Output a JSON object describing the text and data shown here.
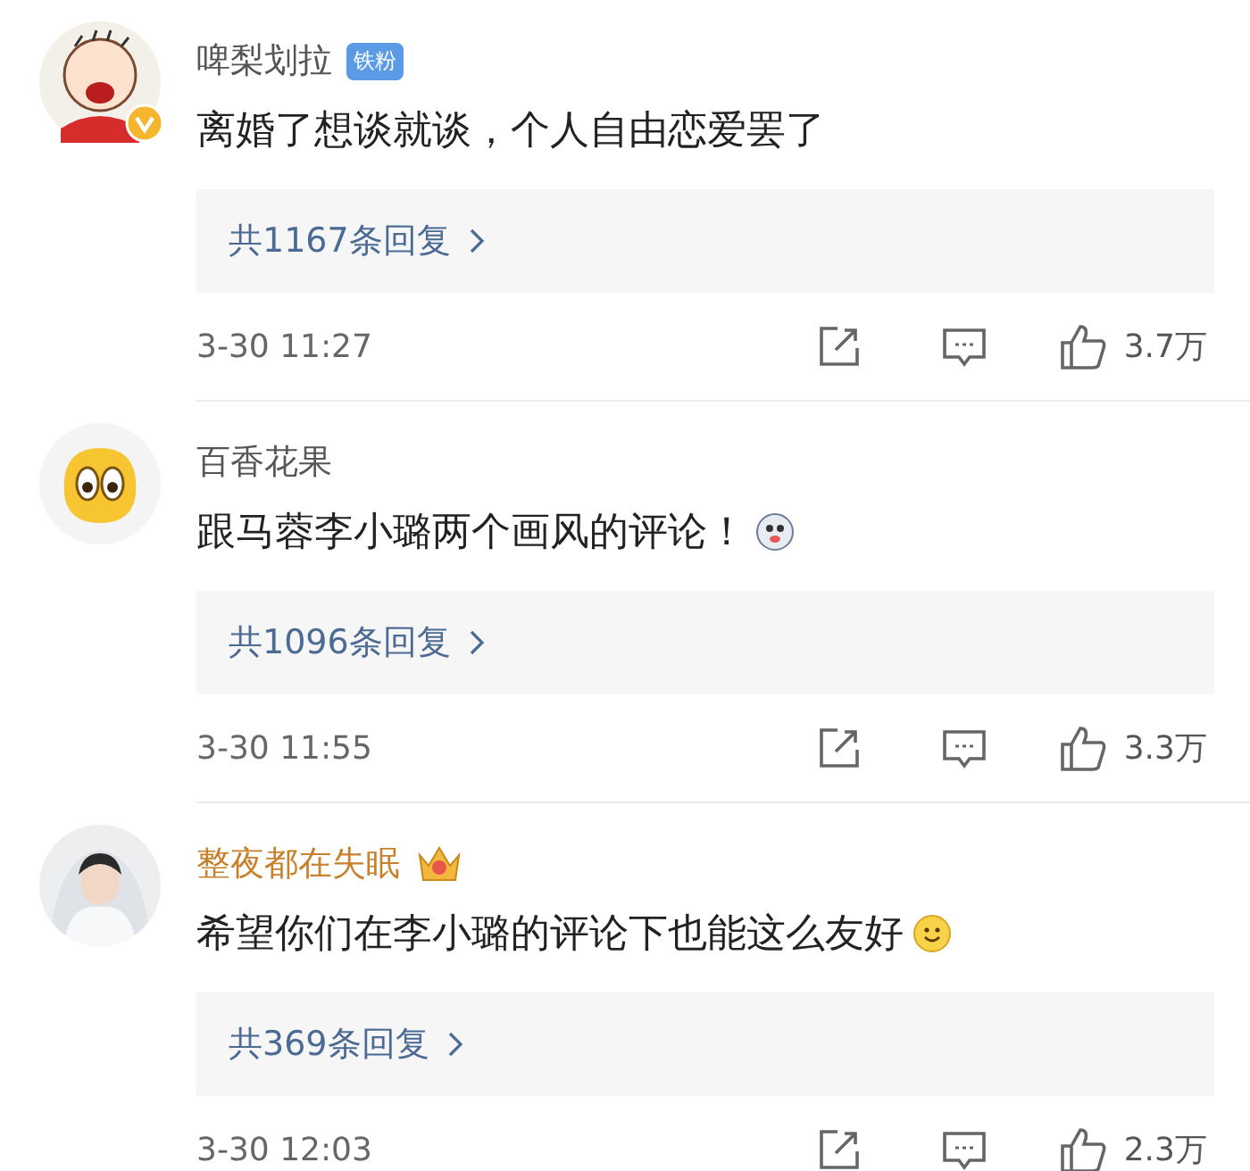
{
  "comments": [
    {
      "avatar": {
        "kind": "cartoon"
      },
      "verified": true,
      "name": "啤梨划拉",
      "vip": false,
      "badge": {
        "kind": "text",
        "label": "铁粉"
      },
      "text": "离婚了想谈就谈，个人自由恋爱罢了",
      "replies": "共1167条回复",
      "time": "3-30 11:27",
      "likes": "3.7万"
    },
    {
      "avatar": {
        "kind": "emoji"
      },
      "verified": false,
      "name": "百香花果",
      "vip": false,
      "badge": {
        "kind": "none"
      },
      "text": "跟马蓉李小璐两个画风的评论！",
      "emoji": {
        "kind": "dog"
      },
      "replies": "共1096条回复",
      "time": "3-30 11:55",
      "likes": "3.3万"
    },
    {
      "verified": false,
      "name": "整夜都在失眠",
      "vip": true,
      "badge": {
        "kind": "crown"
      },
      "text": "希望你们在李小璐的评论下也能这么友好",
      "emoji": {
        "kind": "smile"
      },
      "replies": "共369条回复",
      "time": "3-30 12:03",
      "likes": "2.3万"
    }
  ]
}
